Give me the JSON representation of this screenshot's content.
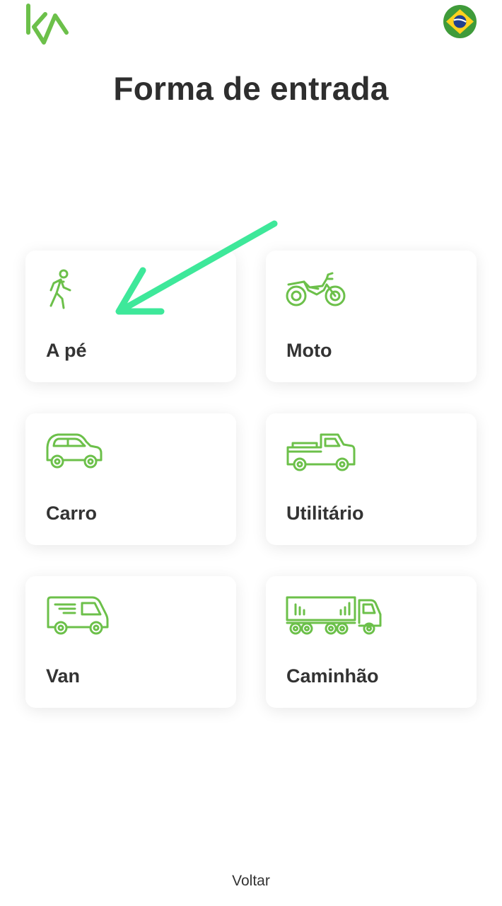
{
  "header": {
    "logo_icon": "ka-logo-icon",
    "language_flag_icon": "brazil-flag-icon"
  },
  "page": {
    "title": "Forma de entrada"
  },
  "options": [
    {
      "label": "A pé",
      "icon": "pedestrian-icon"
    },
    {
      "label": "Moto",
      "icon": "motorcycle-icon"
    },
    {
      "label": "Carro",
      "icon": "car-icon"
    },
    {
      "label": "Utilitário",
      "icon": "pickup-truck-icon"
    },
    {
      "label": "Van",
      "icon": "van-icon"
    },
    {
      "label": "Caminhão",
      "icon": "truck-icon"
    }
  ],
  "footer": {
    "back_label": "Voltar"
  },
  "colors": {
    "accent_green": "#6cc04a",
    "annotation_arrow": "#3ee89a",
    "text": "#2e2e2e"
  }
}
